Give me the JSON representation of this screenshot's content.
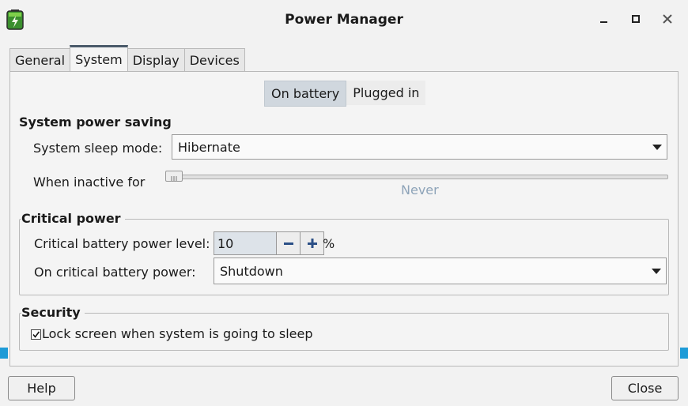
{
  "window": {
    "title": "Power Manager"
  },
  "tabs": [
    {
      "label": "General"
    },
    {
      "label": "System"
    },
    {
      "label": "Display"
    },
    {
      "label": "Devices"
    }
  ],
  "mode_toggle": {
    "on_battery": "On battery",
    "plugged_in": "Plugged in"
  },
  "system_power_saving": {
    "heading": "System power saving",
    "sleep_mode_label": "System sleep mode:",
    "sleep_mode_value": "Hibernate",
    "inactive_label": "When inactive for",
    "inactive_value": "Never"
  },
  "critical_power": {
    "heading": "Critical power",
    "level_label": "Critical battery power level:",
    "level_value": "10",
    "level_unit": "%",
    "action_label": "On critical battery power:",
    "action_value": "Shutdown"
  },
  "security": {
    "heading": "Security",
    "lock_label": "Lock screen when system is going to sleep",
    "lock_checked": true
  },
  "footer": {
    "help": "Help",
    "close": "Close"
  },
  "colors": {
    "accent_stripe": "#1e9bd7",
    "selected_toggle": "#d0d7de"
  }
}
